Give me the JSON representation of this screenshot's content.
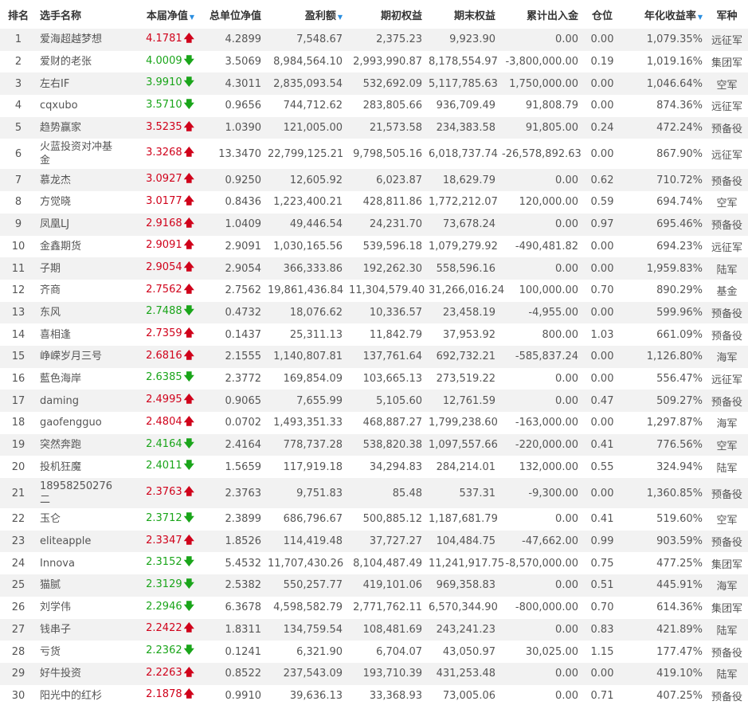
{
  "table": {
    "headers": {
      "rank": "排名",
      "name": "选手名称",
      "current_nav": "本届净值",
      "total_nav": "总单位净值",
      "profit": "盈利额",
      "start_equity": "期初权益",
      "end_equity": "期末权益",
      "cum_flow": "累计出入金",
      "position": "仓位",
      "annual_return": "年化收益率",
      "group": "军种"
    },
    "sort_indicator": "▼",
    "arrow_up": "🡅",
    "arrow_down": "🡇",
    "rows": [
      {
        "rank": "1",
        "name": "爱海超越梦想",
        "nav": "4.1781",
        "dir": "up",
        "total_nav": "4.2899",
        "profit": "7,548.67",
        "start": "2,375.23",
        "end": "9,923.90",
        "flow": "0.00",
        "pos": "0.00",
        "annual": "1,079.35%",
        "group": "远征军"
      },
      {
        "rank": "2",
        "name": "爱财的老张",
        "nav": "4.0009",
        "dir": "down",
        "total_nav": "3.5069",
        "profit": "8,984,564.10",
        "start": "2,993,990.87",
        "end": "8,178,554.97",
        "flow": "-3,800,000.00",
        "pos": "0.19",
        "annual": "1,019.16%",
        "group": "集团军"
      },
      {
        "rank": "3",
        "name": "左右IF",
        "nav": "3.9910",
        "dir": "down",
        "total_nav": "4.3011",
        "profit": "2,835,093.54",
        "start": "532,692.09",
        "end": "5,117,785.63",
        "flow": "1,750,000.00",
        "pos": "0.00",
        "annual": "1,046.64%",
        "group": "空军"
      },
      {
        "rank": "4",
        "name": "cqxubo",
        "nav": "3.5710",
        "dir": "down",
        "total_nav": "0.9656",
        "profit": "744,712.62",
        "start": "283,805.66",
        "end": "936,709.49",
        "flow": "91,808.79",
        "pos": "0.00",
        "annual": "874.36%",
        "group": "远征军"
      },
      {
        "rank": "5",
        "name": "趋势赢家",
        "nav": "3.5235",
        "dir": "up",
        "total_nav": "1.0390",
        "profit": "121,005.00",
        "start": "21,573.58",
        "end": "234,383.58",
        "flow": "91,805.00",
        "pos": "0.24",
        "annual": "472.24%",
        "group": "预备役"
      },
      {
        "rank": "6",
        "name": "火蓝投资对冲基金",
        "nav": "3.3268",
        "dir": "up",
        "total_nav": "13.3470",
        "profit": "22,799,125.21",
        "start": "9,798,505.16",
        "end": "6,018,737.74",
        "flow": "-26,578,892.63",
        "pos": "0.00",
        "annual": "867.90%",
        "group": "远征军"
      },
      {
        "rank": "7",
        "name": "慕龙杰",
        "nav": "3.0927",
        "dir": "up",
        "total_nav": "0.9250",
        "profit": "12,605.92",
        "start": "6,023.87",
        "end": "18,629.79",
        "flow": "0.00",
        "pos": "0.62",
        "annual": "710.72%",
        "group": "预备役"
      },
      {
        "rank": "8",
        "name": "方觉晓",
        "nav": "3.0177",
        "dir": "up",
        "total_nav": "0.8436",
        "profit": "1,223,400.21",
        "start": "428,811.86",
        "end": "1,772,212.07",
        "flow": "120,000.00",
        "pos": "0.59",
        "annual": "694.74%",
        "group": "空军"
      },
      {
        "rank": "9",
        "name": "凤凰LJ",
        "nav": "2.9168",
        "dir": "up",
        "total_nav": "1.0409",
        "profit": "49,446.54",
        "start": "24,231.70",
        "end": "73,678.24",
        "flow": "0.00",
        "pos": "0.97",
        "annual": "695.46%",
        "group": "预备役"
      },
      {
        "rank": "10",
        "name": "金鑫期货",
        "nav": "2.9091",
        "dir": "up",
        "total_nav": "2.9091",
        "profit": "1,030,165.56",
        "start": "539,596.18",
        "end": "1,079,279.92",
        "flow": "-490,481.82",
        "pos": "0.00",
        "annual": "694.23%",
        "group": "远征军"
      },
      {
        "rank": "11",
        "name": "子期",
        "nav": "2.9054",
        "dir": "up",
        "total_nav": "2.9054",
        "profit": "366,333.86",
        "start": "192,262.30",
        "end": "558,596.16",
        "flow": "0.00",
        "pos": "0.00",
        "annual": "1,959.83%",
        "group": "陆军"
      },
      {
        "rank": "12",
        "name": "齐商",
        "nav": "2.7562",
        "dir": "up",
        "total_nav": "2.7562",
        "profit": "19,861,436.84",
        "start": "11,304,579.40",
        "end": "31,266,016.24",
        "flow": "100,000.00",
        "pos": "0.70",
        "annual": "890.29%",
        "group": "基金"
      },
      {
        "rank": "13",
        "name": "东风",
        "nav": "2.7488",
        "dir": "down",
        "total_nav": "0.4732",
        "profit": "18,076.62",
        "start": "10,336.57",
        "end": "23,458.19",
        "flow": "-4,955.00",
        "pos": "0.00",
        "annual": "599.96%",
        "group": "预备役"
      },
      {
        "rank": "14",
        "name": "喜相逢",
        "nav": "2.7359",
        "dir": "up",
        "total_nav": "0.1437",
        "profit": "25,311.13",
        "start": "11,842.79",
        "end": "37,953.92",
        "flow": "800.00",
        "pos": "1.03",
        "annual": "661.09%",
        "group": "预备役"
      },
      {
        "rank": "15",
        "name": "峥嵘岁月三号",
        "nav": "2.6816",
        "dir": "up",
        "total_nav": "2.1555",
        "profit": "1,140,807.81",
        "start": "137,761.64",
        "end": "692,732.21",
        "flow": "-585,837.24",
        "pos": "0.00",
        "annual": "1,126.80%",
        "group": "海军"
      },
      {
        "rank": "16",
        "name": "藍色海岸",
        "nav": "2.6385",
        "dir": "down",
        "total_nav": "2.3772",
        "profit": "169,854.09",
        "start": "103,665.13",
        "end": "273,519.22",
        "flow": "0.00",
        "pos": "0.00",
        "annual": "556.47%",
        "group": "远征军"
      },
      {
        "rank": "17",
        "name": "daming",
        "nav": "2.4995",
        "dir": "up",
        "total_nav": "0.9065",
        "profit": "7,655.99",
        "start": "5,105.60",
        "end": "12,761.59",
        "flow": "0.00",
        "pos": "0.47",
        "annual": "509.27%",
        "group": "预备役"
      },
      {
        "rank": "18",
        "name": "gaofengguo",
        "nav": "2.4804",
        "dir": "up",
        "total_nav": "0.0702",
        "profit": "1,493,351.33",
        "start": "468,887.27",
        "end": "1,799,238.60",
        "flow": "-163,000.00",
        "pos": "0.00",
        "annual": "1,297.87%",
        "group": "海军"
      },
      {
        "rank": "19",
        "name": "突然奔跑",
        "nav": "2.4164",
        "dir": "down",
        "total_nav": "2.4164",
        "profit": "778,737.28",
        "start": "538,820.38",
        "end": "1,097,557.66",
        "flow": "-220,000.00",
        "pos": "0.41",
        "annual": "776.56%",
        "group": "空军"
      },
      {
        "rank": "20",
        "name": "投机狂魔",
        "nav": "2.4011",
        "dir": "down",
        "total_nav": "1.5659",
        "profit": "117,919.18",
        "start": "34,294.83",
        "end": "284,214.01",
        "flow": "132,000.00",
        "pos": "0.55",
        "annual": "324.94%",
        "group": "陆军"
      },
      {
        "rank": "21",
        "name": "18958250276二",
        "nav": "2.3763",
        "dir": "up",
        "total_nav": "2.3763",
        "profit": "9,751.83",
        "start": "85.48",
        "end": "537.31",
        "flow": "-9,300.00",
        "pos": "0.00",
        "annual": "1,360.85%",
        "group": "预备役"
      },
      {
        "rank": "22",
        "name": "玉仑",
        "nav": "2.3712",
        "dir": "down",
        "total_nav": "2.3899",
        "profit": "686,796.67",
        "start": "500,885.12",
        "end": "1,187,681.79",
        "flow": "0.00",
        "pos": "0.41",
        "annual": "519.60%",
        "group": "空军"
      },
      {
        "rank": "23",
        "name": "eliteapple",
        "nav": "2.3347",
        "dir": "up",
        "total_nav": "1.8526",
        "profit": "114,419.48",
        "start": "37,727.27",
        "end": "104,484.75",
        "flow": "-47,662.00",
        "pos": "0.99",
        "annual": "903.59%",
        "group": "预备役"
      },
      {
        "rank": "24",
        "name": "Innova",
        "nav": "2.3152",
        "dir": "down",
        "total_nav": "5.4532",
        "profit": "11,707,430.26",
        "start": "8,104,487.49",
        "end": "11,241,917.75",
        "flow": "-8,570,000.00",
        "pos": "0.75",
        "annual": "477.25%",
        "group": "集团军"
      },
      {
        "rank": "25",
        "name": "猫腻",
        "nav": "2.3129",
        "dir": "down",
        "total_nav": "2.5382",
        "profit": "550,257.77",
        "start": "419,101.06",
        "end": "969,358.83",
        "flow": "0.00",
        "pos": "0.51",
        "annual": "445.91%",
        "group": "海军"
      },
      {
        "rank": "26",
        "name": "刘学伟",
        "nav": "2.2946",
        "dir": "down",
        "total_nav": "6.3678",
        "profit": "4,598,582.79",
        "start": "2,771,762.11",
        "end": "6,570,344.90",
        "flow": "-800,000.00",
        "pos": "0.70",
        "annual": "614.36%",
        "group": "集团军"
      },
      {
        "rank": "27",
        "name": "钱串子",
        "nav": "2.2422",
        "dir": "up",
        "total_nav": "1.8311",
        "profit": "134,759.54",
        "start": "108,481.69",
        "end": "243,241.23",
        "flow": "0.00",
        "pos": "0.83",
        "annual": "421.89%",
        "group": "陆军"
      },
      {
        "rank": "28",
        "name": "亏货",
        "nav": "2.2362",
        "dir": "down",
        "total_nav": "0.1241",
        "profit": "6,321.90",
        "start": "6,704.07",
        "end": "43,050.97",
        "flow": "30,025.00",
        "pos": "1.15",
        "annual": "177.47%",
        "group": "预备役"
      },
      {
        "rank": "29",
        "name": "好牛投资",
        "nav": "2.2263",
        "dir": "up",
        "total_nav": "0.8522",
        "profit": "237,543.09",
        "start": "193,710.39",
        "end": "431,253.48",
        "flow": "0.00",
        "pos": "0.00",
        "annual": "419.10%",
        "group": "陆军"
      },
      {
        "rank": "30",
        "name": "阳光中的红杉",
        "nav": "2.1878",
        "dir": "up",
        "total_nav": "0.9910",
        "profit": "39,636.13",
        "start": "33,368.93",
        "end": "73,005.06",
        "flow": "0.00",
        "pos": "0.71",
        "annual": "407.25%",
        "group": "预备役"
      }
    ]
  },
  "colors": {
    "up": "#d0021b",
    "down": "#1aa51a",
    "sort": "#2a8ee0",
    "stripe": "#f2f2f2"
  }
}
